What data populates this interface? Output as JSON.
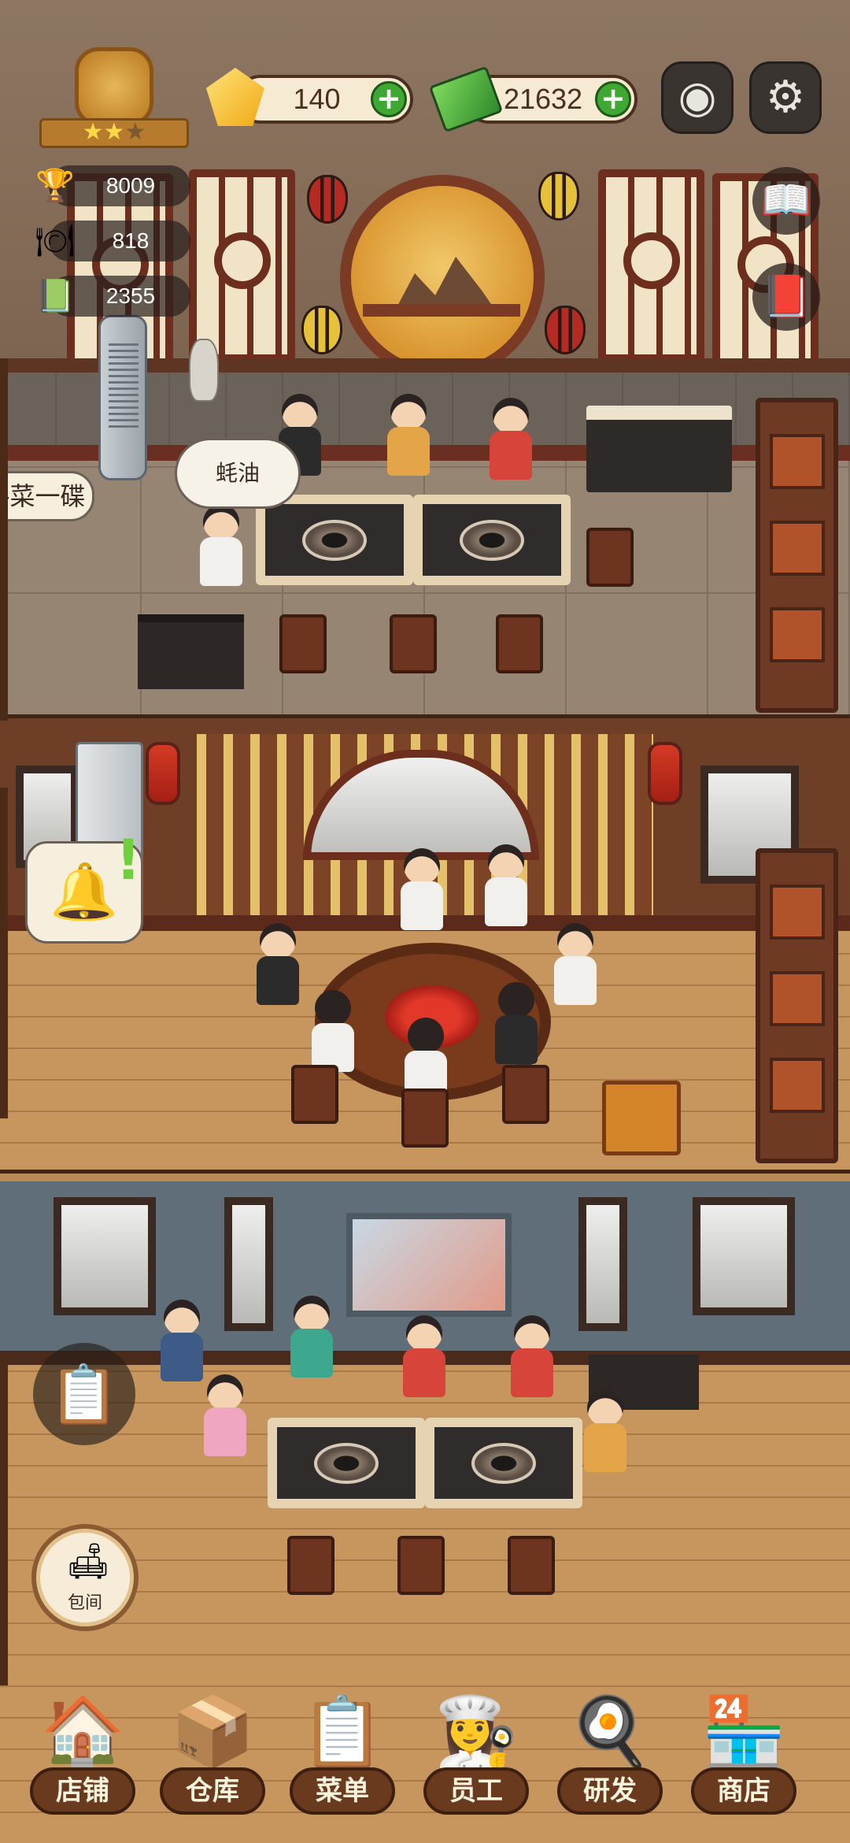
{
  "hud": {
    "rating_stars": {
      "filled": 2,
      "total": 3
    },
    "gems": "140",
    "cash": "21632",
    "stats": [
      {
        "icon": "trophy-icon",
        "value": "8009"
      },
      {
        "icon": "serving-tray-icon",
        "value": "818"
      },
      {
        "icon": "menu-book-icon",
        "value": "2355"
      }
    ]
  },
  "room1": {
    "speech_bubble": "蚝油",
    "left_banner": "-菜一碟"
  },
  "room_button_label": "包间",
  "nav": [
    {
      "label": "店铺",
      "icon": "shop-house-icon"
    },
    {
      "label": "仓库",
      "icon": "warehouse-boxes-icon"
    },
    {
      "label": "菜单",
      "icon": "menu-clipboard-icon"
    },
    {
      "label": "员工",
      "icon": "staff-chef-icon"
    },
    {
      "label": "研发",
      "icon": "research-wok-icon"
    },
    {
      "label": "商店",
      "icon": "store-stall-icon"
    }
  ],
  "colors": {
    "accent_green": "#3fa832",
    "hud_pill": "#f6ebd2",
    "nav_label_bg": "#6a3a1e"
  }
}
